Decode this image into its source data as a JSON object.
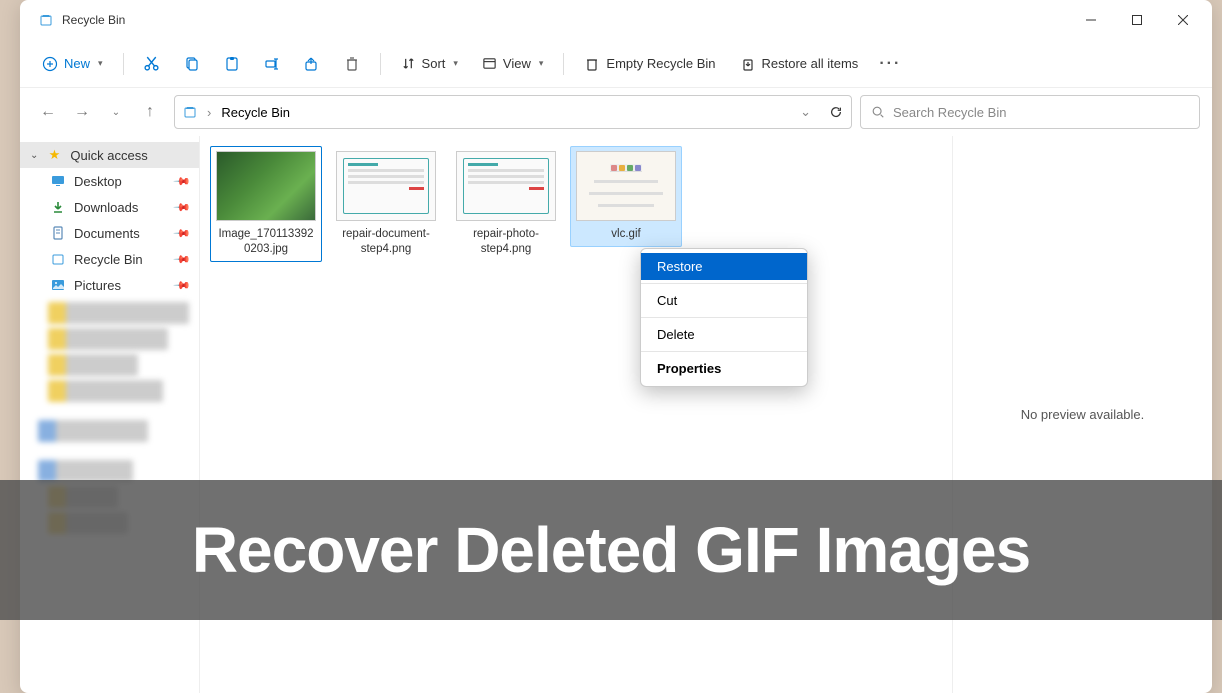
{
  "window": {
    "title": "Recycle Bin"
  },
  "toolbar": {
    "new": "New",
    "sort": "Sort",
    "view": "View",
    "empty": "Empty Recycle Bin",
    "restore_all": "Restore all items"
  },
  "breadcrumb": {
    "location": "Recycle Bin"
  },
  "search": {
    "placeholder": "Search Recycle Bin"
  },
  "sidebar": {
    "quick_access": "Quick access",
    "items": [
      {
        "label": "Desktop"
      },
      {
        "label": "Downloads"
      },
      {
        "label": "Documents"
      },
      {
        "label": "Recycle Bin"
      },
      {
        "label": "Pictures"
      }
    ]
  },
  "files": [
    {
      "name": "Image_170113392\n0203.jpg"
    },
    {
      "name": "repair-document-step4.png"
    },
    {
      "name": "repair-photo-step4.png"
    },
    {
      "name": "vlc.gif"
    }
  ],
  "context_menu": {
    "restore": "Restore",
    "cut": "Cut",
    "delete": "Delete",
    "properties": "Properties"
  },
  "preview": {
    "empty": "No preview available."
  },
  "overlay": {
    "text": "Recover Deleted GIF Images"
  }
}
